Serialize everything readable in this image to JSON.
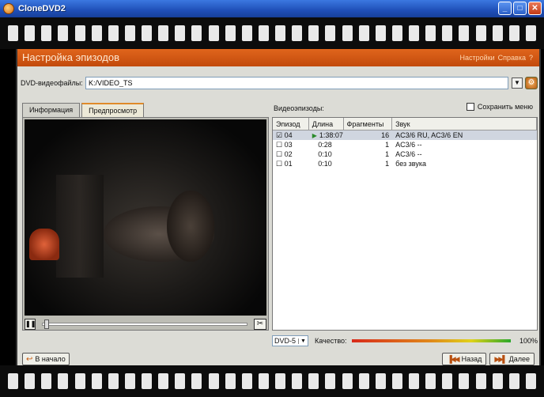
{
  "window": {
    "title": "CloneDVD2",
    "minimize": "_",
    "maximize": "□",
    "close": "✕"
  },
  "header": {
    "title": "Настройка эпизодов",
    "links": [
      "Настройки",
      "Справка",
      "?"
    ]
  },
  "file": {
    "label": "DVD-видеофайлы:",
    "value": "K:/VIDEO_TS"
  },
  "tabs": [
    {
      "label": "Информация",
      "active": false
    },
    {
      "label": "Предпросмотр",
      "active": true
    }
  ],
  "episodes": {
    "label": "Видеоэпизоды:",
    "save_memo": "Сохранить меню",
    "columns": [
      "Эпизод",
      "Длина",
      "Фрагменты",
      "Звук"
    ],
    "rows": [
      {
        "checked": "☑",
        "episode": "04",
        "length": "1:38:07",
        "fragments": "16",
        "audio": "AC3/6 RU, AC3/6 EN",
        "selected": true
      },
      {
        "checked": "☐",
        "episode": "03",
        "length": "0:28",
        "fragments": "1",
        "audio": "AC3/6 --",
        "selected": false
      },
      {
        "checked": "☐",
        "episode": "02",
        "length": "0:10",
        "fragments": "1",
        "audio": "AC3/6 --",
        "selected": false
      },
      {
        "checked": "☐",
        "episode": "01",
        "length": "0:10",
        "fragments": "1",
        "audio": "без звука",
        "selected": false
      }
    ]
  },
  "output": {
    "format": "DVD-5",
    "quality_label": "Качество:",
    "quality_value": "100%"
  },
  "nav": {
    "start": "В начало",
    "back": "Назад",
    "next": "Далее"
  },
  "icons": {
    "app": "clonedvd-icon",
    "pause": "pause-icon",
    "cut": "scissors-icon",
    "settings": "gear-icon",
    "dropdown": "chevron-down-icon",
    "play": "play-icon"
  },
  "colors": {
    "header": "#d85a14",
    "titlebar": "#245edc",
    "film": "#0c0c0c"
  }
}
